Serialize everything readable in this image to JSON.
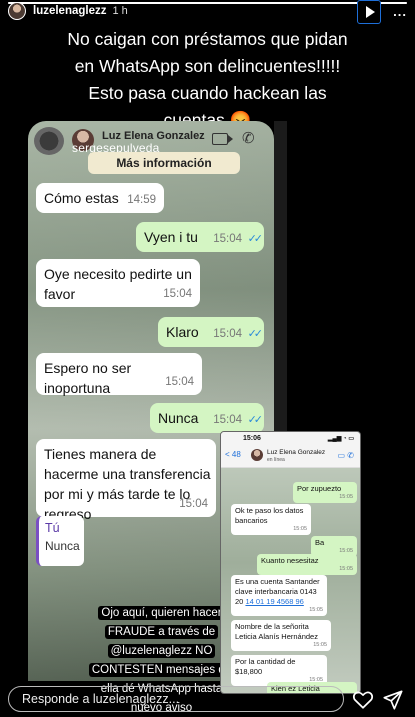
{
  "story": {
    "username": "luzelenaglezz",
    "time": "1 h",
    "more": "...",
    "progress_fraction": 1.0,
    "caption": "No caigan con préstamos que pidan en WhatsApp son delincuentes!!!!! Esto pasa cuando hackean las cuentas 😡"
  },
  "chat": {
    "contact_name": "Luz Elena Gonzalez",
    "username_overlay": "sergesepulveda",
    "more_info": "Más información",
    "messages": [
      {
        "dir": "in",
        "text": "Cómo estas",
        "time": "14:59"
      },
      {
        "dir": "out",
        "text": "Vyen i tu",
        "time": "15:04"
      },
      {
        "dir": "in",
        "text": "Oye necesito pedirte un favor",
        "time": "15:04"
      },
      {
        "dir": "out",
        "text": "Klaro",
        "time": "15:04"
      },
      {
        "dir": "in",
        "text": "Espero no ser inoportuna",
        "time": "15:04"
      },
      {
        "dir": "out",
        "text": "Nunca",
        "time": "15:04"
      },
      {
        "dir": "in",
        "text": "Tienes manera de hacerme una transferencia por mi y más tarde te lo regreso",
        "time": "15:04"
      }
    ],
    "reply_preview": {
      "who": "Tú",
      "what": "Nunca"
    },
    "warning": "Ojo aquí, quieren hacer FRAUDE a través de @luzelenaglezz NO CONTESTEN mensajes de ella dé WhatsApp hasta nuevo aviso"
  },
  "small_chat": {
    "clock": "15:06",
    "back": "< 48",
    "contact_name": "Luz Elena Gonzalez",
    "contact_sub": "en línea",
    "messages": [
      {
        "dir": "out",
        "text": "Por zupuezto",
        "time": "15:05"
      },
      {
        "dir": "in",
        "text": "Ok te paso los datos bancarios",
        "time": "15:05"
      },
      {
        "dir": "out",
        "text": "Ba",
        "time": "15:05"
      },
      {
        "dir": "out",
        "text": "Kuanto nesesitaz",
        "time": "15:05"
      },
      {
        "dir": "in",
        "text": "Es una cuenta Santander clave interbancaria 0143 20 ",
        "link": "14 01 19 4568 96",
        "time": "15:05"
      },
      {
        "dir": "in",
        "text": "Nombre de la señorita Leticia Alanís Hernández",
        "time": "15:05"
      },
      {
        "dir": "in",
        "text": "Por la cantidad de $18,800",
        "time": "15:05"
      },
      {
        "dir": "out",
        "text": "Kien ez Leticia",
        "time": ""
      }
    ]
  },
  "reply_bar": {
    "placeholder": "Responde a luzelenaglezz..."
  },
  "colors": {
    "link_blue": "#1e6fd9",
    "outgoing_bubble": "#d4f5c3",
    "read_ticks": "#2b8ad9"
  }
}
